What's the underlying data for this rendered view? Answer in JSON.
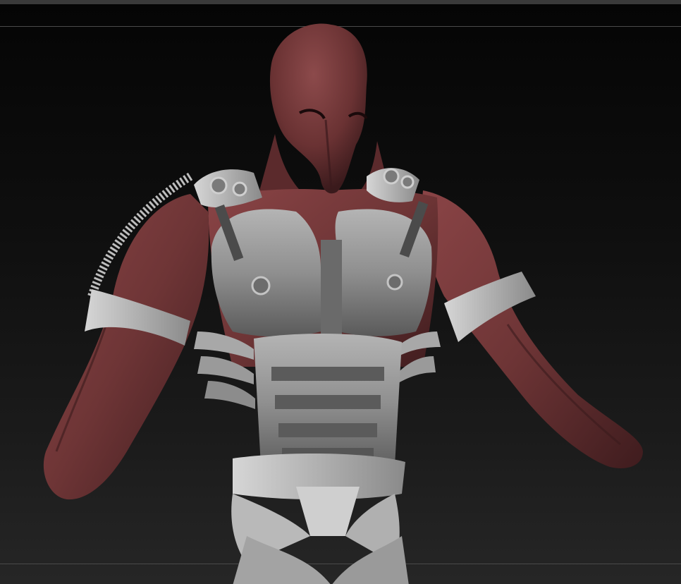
{
  "app": {
    "colors": {
      "background": "#0b0b0b",
      "toolbar": "#3a3a3a",
      "guide_line": "#4a4a4a",
      "skin_material": "#6e3536",
      "armor_material": "#9a9a9a"
    }
  },
  "canvas": {
    "subject": "sculpted-bust"
  }
}
